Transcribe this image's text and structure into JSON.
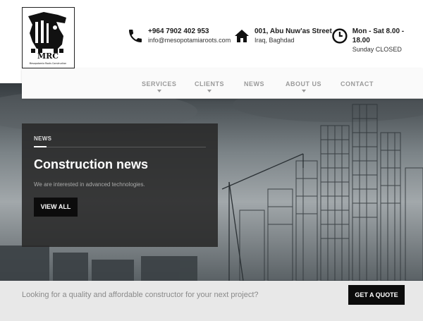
{
  "header": {
    "logo_text": "MRC",
    "logo_subtext": "Mesopotamia Roots Construction",
    "phone": {
      "line1": "+964 7902 402 953",
      "line2": "info@mesopotamiaroots.com",
      "icon": "phone-icon"
    },
    "address": {
      "line1": "001, Abu Nuw'as Street",
      "line2": "Iraq, Baghdad",
      "icon": "home-icon"
    },
    "hours": {
      "line1": "Mon - Sat 8.00 - 18.00",
      "line2": "Sunday CLOSED",
      "icon": "clock-icon"
    }
  },
  "nav": {
    "items": [
      {
        "label": "SERVICES",
        "has_dropdown": true
      },
      {
        "label": "CLIENTS",
        "has_dropdown": true
      },
      {
        "label": "NEWS",
        "has_dropdown": false
      },
      {
        "label": "ABOUT US",
        "has_dropdown": true
      },
      {
        "label": "CONTACT",
        "has_dropdown": false
      }
    ]
  },
  "card": {
    "label": "NEWS",
    "title": "Construction news",
    "description": "We are interested in advanced technologies.",
    "button": "VIEW ALL"
  },
  "cta": {
    "text": "Looking for a quality and affordable constructor for your next project?",
    "button": "GET A QUOTE"
  },
  "colors": {
    "dark": "#0c0c0c",
    "nav_text": "#9a9a9a",
    "cta_bg": "#e8e8e8"
  }
}
